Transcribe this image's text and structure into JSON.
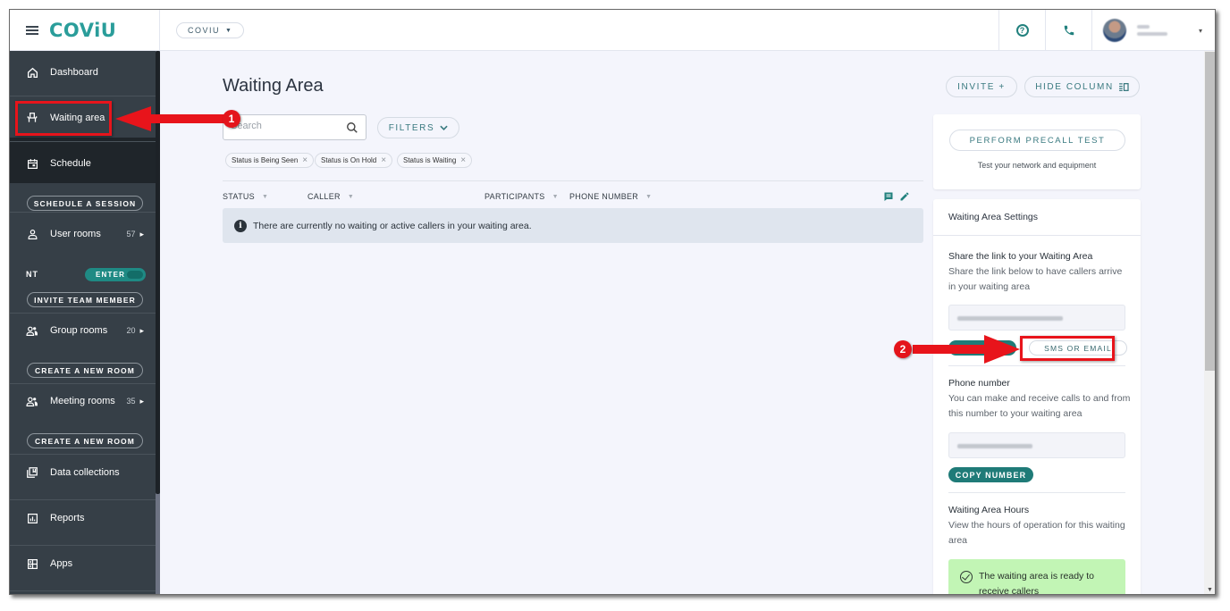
{
  "header": {
    "logo": "COViU",
    "org_selector": "COVIU",
    "help_icon": "help-circle-icon",
    "phone_icon": "phone-icon",
    "user_avatar": "avatar-blurred",
    "user_menu_caret": "▾"
  },
  "sidebar": {
    "items": [
      {
        "label": "Dashboard",
        "icon": "home-icon"
      },
      {
        "label": "Waiting area",
        "icon": "waiting-chair-icon"
      },
      {
        "label": "Schedule",
        "icon": "calendar-icon"
      },
      {
        "label": "User rooms",
        "icon": "user-icon",
        "count": "57"
      },
      {
        "label": "Group rooms",
        "icon": "group-icon",
        "count": "20"
      },
      {
        "label": "Meeting rooms",
        "icon": "group-icon",
        "count": "35"
      },
      {
        "label": "Data collections",
        "icon": "collection-icon"
      },
      {
        "label": "Reports",
        "icon": "chart-icon"
      },
      {
        "label": "Apps",
        "icon": "apps-icon"
      }
    ],
    "schedule_button": "SCHEDULE A SESSION",
    "user_initials": "NT",
    "enter_toggle": "ENTER",
    "invite_team_button": "INVITE TEAM MEMBER",
    "create_group_room_button": "CREATE A NEW ROOM",
    "create_meeting_room_button": "CREATE A NEW ROOM"
  },
  "main": {
    "title": "Waiting Area",
    "search_placeholder": "Search",
    "filters_button": "FILTERS",
    "filter_chips": [
      "Status is Being Seen",
      "Status is On Hold",
      "Status is Waiting"
    ],
    "columns": [
      "STATUS",
      "CALLER",
      "PARTICIPANTS",
      "PHONE NUMBER"
    ],
    "empty_message": "There are currently no waiting or active callers in your waiting area."
  },
  "right": {
    "invite_button": "INVITE +",
    "hide_column_button": "HIDE COLUMN",
    "precall_button": "PERFORM PRECALL TEST",
    "precall_sub": "Test your network and equipment",
    "settings_title": "Waiting Area Settings",
    "share_title": "Share the link to your Waiting Area",
    "share_desc": "Share the link below to have callers arrive in your waiting area",
    "sms_email_button": "SMS OR EMAIL",
    "phone_title": "Phone number",
    "phone_desc": "You can make and receive calls to and from this number to your waiting area",
    "copy_number_button": "COPY NUMBER",
    "hours_title": "Waiting Area Hours",
    "hours_desc": "View the hours of operation for this waiting area",
    "ready_message": "The waiting area is ready to receive callers"
  },
  "annotations": {
    "step1": "1",
    "step2": "2"
  },
  "colors": {
    "accent": "#1f7b78",
    "sidebar_bg": "#363f47",
    "annotation_red": "#e8141b",
    "ready_green": "#c2f5b5"
  }
}
